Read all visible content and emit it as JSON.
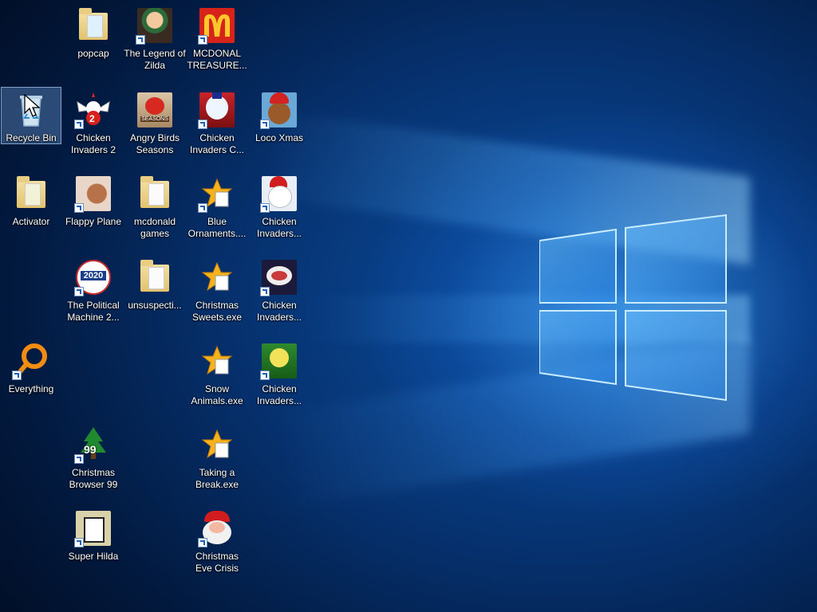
{
  "desktop": {
    "icons": {
      "popcap": "popcap",
      "legend_zilda": "The Legend of Zilda",
      "mcdonal_treasure": "MCDONAL TREASURE...",
      "recycle_bin": "Recycle Bin",
      "chicken_invaders_2": "Chicken Invaders 2",
      "angry_birds_seasons": "Angry Birds Seasons",
      "chicken_invaders_c": "Chicken Invaders C...",
      "loco_xmas": "Loco Xmas",
      "activator": "Activator",
      "flappy_plane": "Flappy Plane",
      "mcdonald_games": "mcdonald games",
      "blue_ornaments": "Blue Ornaments....",
      "chicken_invaders_a": "Chicken Invaders...",
      "political_machine": "The Political Machine 2...",
      "unsuspecti": "unsuspecti...",
      "christmas_sweets": "Christmas Sweets.exe",
      "chicken_invaders_b": "Chicken Invaders...",
      "everything": "Everything",
      "snow_animals": "Snow Animals.exe",
      "chicken_invaders_d": "Chicken Invaders...",
      "christmas_browser": "Christmas Browser 99",
      "taking_a_break": "Taking a Break.exe",
      "super_hilda": "Super Hilda",
      "christmas_eve_crisis": "Christmas Eve Crisis"
    },
    "glyph_text": {
      "political_badge": "2020",
      "browser_badge": "99",
      "angry_birds_badge": "SEASONS",
      "chicken_2_badge": "2"
    },
    "colors": {
      "wallpaper_dark": "#021a40",
      "wallpaper_mid": "#0b4fa3",
      "logo_glow": "#9fd8ff",
      "label_text": "#ffffff",
      "selection": "#78aae6"
    }
  }
}
